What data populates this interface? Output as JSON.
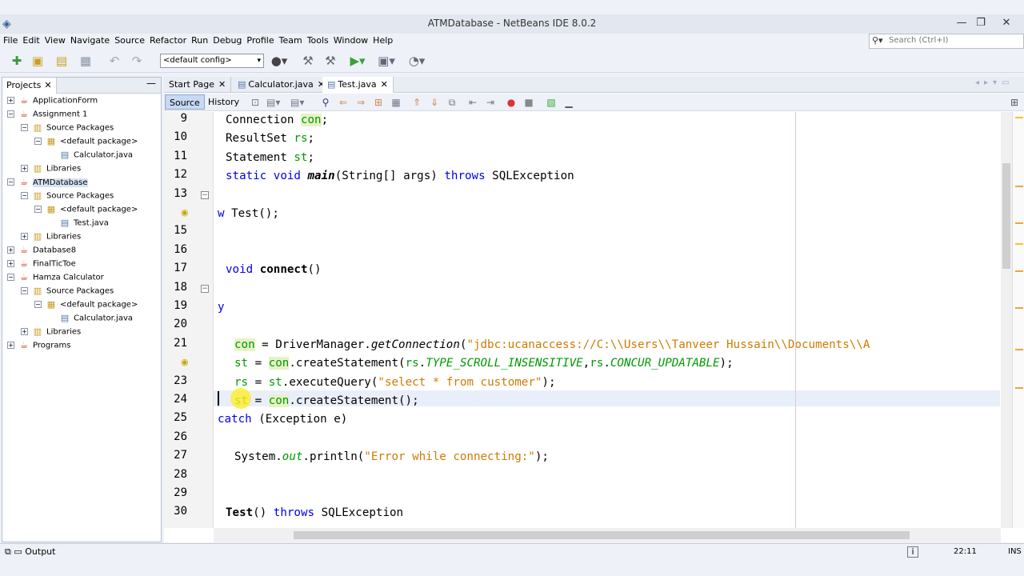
{
  "window": {
    "title": "ATMDatabase - NetBeans IDE 8.0.2"
  },
  "menu": [
    "File",
    "Edit",
    "View",
    "Navigate",
    "Source",
    "Refactor",
    "Run",
    "Debug",
    "Profile",
    "Team",
    "Tools",
    "Window",
    "Help"
  ],
  "search": {
    "placeholder": "Search (Ctrl+I)"
  },
  "toolbar": {
    "config": "<default config>"
  },
  "projects": {
    "tab_label": "Projects",
    "tree": [
      {
        "label": "ApplicationForm",
        "icon": "project-cup-icon",
        "exp": "+"
      },
      {
        "label": "Assignment 1",
        "icon": "project-cup-icon",
        "exp": "−"
      },
      {
        "label": "Source Packages",
        "icon": "source-packages-icon",
        "exp": "−"
      },
      {
        "label": "<default package>",
        "icon": "package-icon",
        "exp": "−"
      },
      {
        "label": "Calculator.java",
        "icon": "java-file-icon",
        "exp": ""
      },
      {
        "label": "Libraries",
        "icon": "libraries-icon",
        "exp": "+"
      },
      {
        "label": "ATMDatabase",
        "icon": "project-cup-icon",
        "exp": "−",
        "selected": true
      },
      {
        "label": "Source Packages",
        "icon": "source-packages-icon",
        "exp": "−"
      },
      {
        "label": "<default package>",
        "icon": "package-icon",
        "exp": "−"
      },
      {
        "label": "Test.java",
        "icon": "java-file-icon",
        "exp": ""
      },
      {
        "label": "Libraries",
        "icon": "libraries-icon",
        "exp": "+"
      },
      {
        "label": "Database8",
        "icon": "project-cup-icon",
        "exp": "+"
      },
      {
        "label": "FinalTicToe",
        "icon": "project-cup-icon",
        "exp": "+"
      },
      {
        "label": "Hamza Calculator",
        "icon": "project-cup-icon",
        "exp": "−"
      },
      {
        "label": "Source Packages",
        "icon": "source-packages-icon",
        "exp": "−"
      },
      {
        "label": "<default package>",
        "icon": "package-icon",
        "exp": "−"
      },
      {
        "label": "Calculator.java",
        "icon": "java-file-icon",
        "exp": ""
      },
      {
        "label": "Libraries",
        "icon": "libraries-icon",
        "exp": "+"
      },
      {
        "label": "Programs",
        "icon": "project-cup-icon",
        "exp": "+"
      }
    ]
  },
  "editor": {
    "tabs": [
      {
        "label": "Start Page",
        "icon": ""
      },
      {
        "label": "Calculator.java",
        "icon": "java-file-icon"
      },
      {
        "label": "Test.java",
        "icon": "java-file-icon",
        "active": true
      }
    ],
    "source_label": "Source",
    "history_label": "History",
    "lines": [
      {
        "n": "9",
        "indent": 1,
        "segs": [
          [
            "Connection ",
            ""
          ],
          [
            "con",
            "hl fld"
          ],
          [
            ";",
            ""
          ]
        ]
      },
      {
        "n": "10",
        "indent": 1,
        "segs": [
          [
            "ResultSet ",
            ""
          ],
          [
            "rs",
            "fld"
          ],
          [
            ";",
            ""
          ]
        ]
      },
      {
        "n": "11",
        "indent": 1,
        "segs": [
          [
            "Statement ",
            ""
          ],
          [
            "st",
            "fld"
          ],
          [
            ";",
            ""
          ]
        ]
      },
      {
        "n": "12",
        "indent": 1,
        "segs": [
          [
            "static ",
            "kw"
          ],
          [
            "void ",
            "kw"
          ],
          [
            "main",
            "bi"
          ],
          [
            "(String[] args) ",
            ""
          ],
          [
            "throws ",
            "kw"
          ],
          [
            "SQLException",
            ""
          ]
        ]
      },
      {
        "n": "13",
        "indent": 0,
        "segs": [],
        "fold": true
      },
      {
        "n": "",
        "indent": 0,
        "segs": [
          [
            "w ",
            "kw"
          ],
          [
            "Test();",
            ""
          ]
        ],
        "bulb": true
      },
      {
        "n": "15",
        "indent": 0,
        "segs": []
      },
      {
        "n": "16",
        "indent": 0,
        "segs": []
      },
      {
        "n": "17",
        "indent": 1,
        "segs": [
          [
            "void ",
            "kw"
          ],
          [
            "connect",
            "b"
          ],
          [
            "()",
            ""
          ]
        ]
      },
      {
        "n": "18",
        "indent": 0,
        "segs": [],
        "fold": true
      },
      {
        "n": "19",
        "indent": 0,
        "segs": [
          [
            "y",
            "kw"
          ]
        ]
      },
      {
        "n": "20",
        "indent": 0,
        "segs": []
      },
      {
        "n": "21",
        "indent": 2,
        "segs": [
          [
            "con",
            "hl fld"
          ],
          [
            " = DriverManager.",
            ""
          ],
          [
            "getConnection",
            "it"
          ],
          [
            "(",
            ""
          ],
          [
            "\"jdbc:ucanaccess://C:\\\\Users\\\\Tanveer Hussain\\\\Documents\\\\A",
            "str"
          ]
        ]
      },
      {
        "n": "",
        "indent": 2,
        "segs": [
          [
            "st",
            "fld"
          ],
          [
            " = ",
            ""
          ],
          [
            "con",
            "hl fld"
          ],
          [
            ".createStatement(",
            ""
          ],
          [
            "rs",
            "fld"
          ],
          [
            ".",
            ""
          ],
          [
            "TYPE_SCROLL_INSENSITIVE",
            "fldi"
          ],
          [
            ",",
            ""
          ],
          [
            "rs",
            "fld"
          ],
          [
            ".",
            ""
          ],
          [
            "CONCUR_UPDATABLE",
            "fldi"
          ],
          [
            ");",
            ""
          ]
        ],
        "bulb": true
      },
      {
        "n": "23",
        "indent": 2,
        "segs": [
          [
            "rs",
            "fld"
          ],
          [
            " = ",
            ""
          ],
          [
            "st",
            "fld"
          ],
          [
            ".executeQuery(",
            ""
          ],
          [
            "\"select * from customer\"",
            "str"
          ],
          [
            ");",
            ""
          ]
        ]
      },
      {
        "n": "24",
        "indent": 2,
        "segs": [
          [
            "st",
            "fld"
          ],
          [
            " = ",
            ""
          ],
          [
            "con",
            "hl fld"
          ],
          [
            ".createStatement();",
            ""
          ]
        ]
      },
      {
        "n": "25",
        "indent": 0,
        "segs": [
          [
            "catch ",
            "kw"
          ],
          [
            "(Exception ",
            ""
          ],
          [
            "e",
            ""
          ],
          [
            ")",
            ""
          ]
        ]
      },
      {
        "n": "26",
        "indent": 0,
        "segs": []
      },
      {
        "n": "27",
        "indent": 2,
        "segs": [
          [
            "System.",
            ""
          ],
          [
            "out",
            "fldi"
          ],
          [
            ".println(",
            ""
          ],
          [
            "\"Error while connecting:\"",
            "str"
          ],
          [
            ");",
            ""
          ]
        ]
      },
      {
        "n": "28",
        "indent": 0,
        "segs": []
      },
      {
        "n": "29",
        "indent": 0,
        "segs": []
      },
      {
        "n": "30",
        "indent": 1,
        "segs": [
          [
            "Test",
            "b"
          ],
          [
            "() ",
            ""
          ],
          [
            "throws ",
            "kw"
          ],
          [
            "SQLException",
            ""
          ]
        ]
      }
    ]
  },
  "status": {
    "output_label": "Output",
    "caret": "22:11",
    "mode": "INS"
  }
}
